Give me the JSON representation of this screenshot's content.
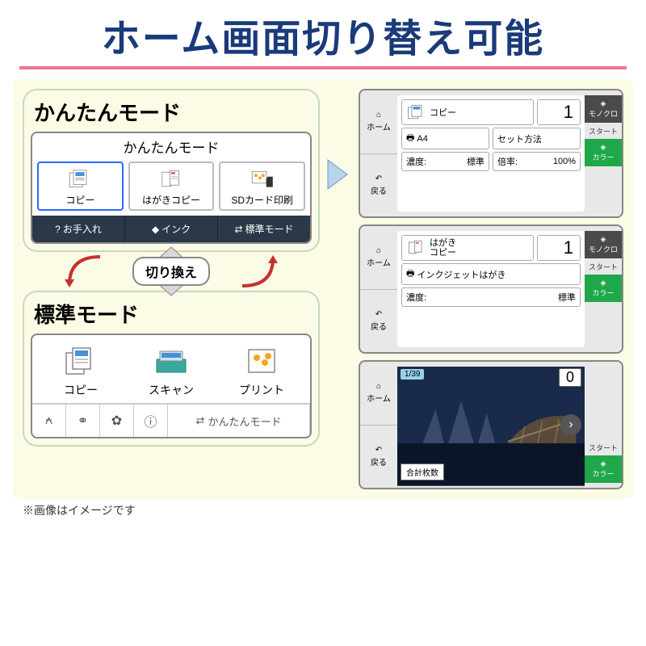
{
  "title": "ホーム画面切り替え可能",
  "simple_mode": {
    "label": "かんたんモード",
    "header": "かんたんモード",
    "items": [
      {
        "label": "コピー"
      },
      {
        "label": "はがきコピー"
      },
      {
        "label": "SDカード印刷"
      }
    ],
    "bottom": {
      "maintenance": "お手入れ",
      "ink": "インク",
      "switch_mode": "標準モード"
    }
  },
  "swap": {
    "label": "切り換え"
  },
  "standard_mode": {
    "label": "標準モード",
    "items": [
      {
        "label": "コピー"
      },
      {
        "label": "スキャン"
      },
      {
        "label": "プリント"
      }
    ],
    "bottom_switch": "かんたんモード"
  },
  "screen_copy": {
    "home": "ホーム",
    "back": "戻る",
    "title": "コピー",
    "count": "1",
    "paper": "A4",
    "set_method": "セット方法",
    "density_label": "濃度:",
    "density_value": "標準",
    "ratio_label": "倍率:",
    "ratio_value": "100%",
    "mono": "モノクロ",
    "start": "スタート",
    "color": "カラー"
  },
  "screen_hagaki": {
    "home": "ホーム",
    "back": "戻る",
    "title": "はがき\nコピー",
    "count": "1",
    "paper": "インクジェットはがき",
    "density_label": "濃度:",
    "density_value": "標準",
    "mono": "モノクロ",
    "start": "スタート",
    "color": "カラー"
  },
  "screen_photo": {
    "home": "ホーム",
    "back": "戻る",
    "page": "1/39",
    "count": "0",
    "total_label": "合計枚数",
    "start": "スタート",
    "color": "カラー"
  },
  "note": "※画像はイメージです"
}
